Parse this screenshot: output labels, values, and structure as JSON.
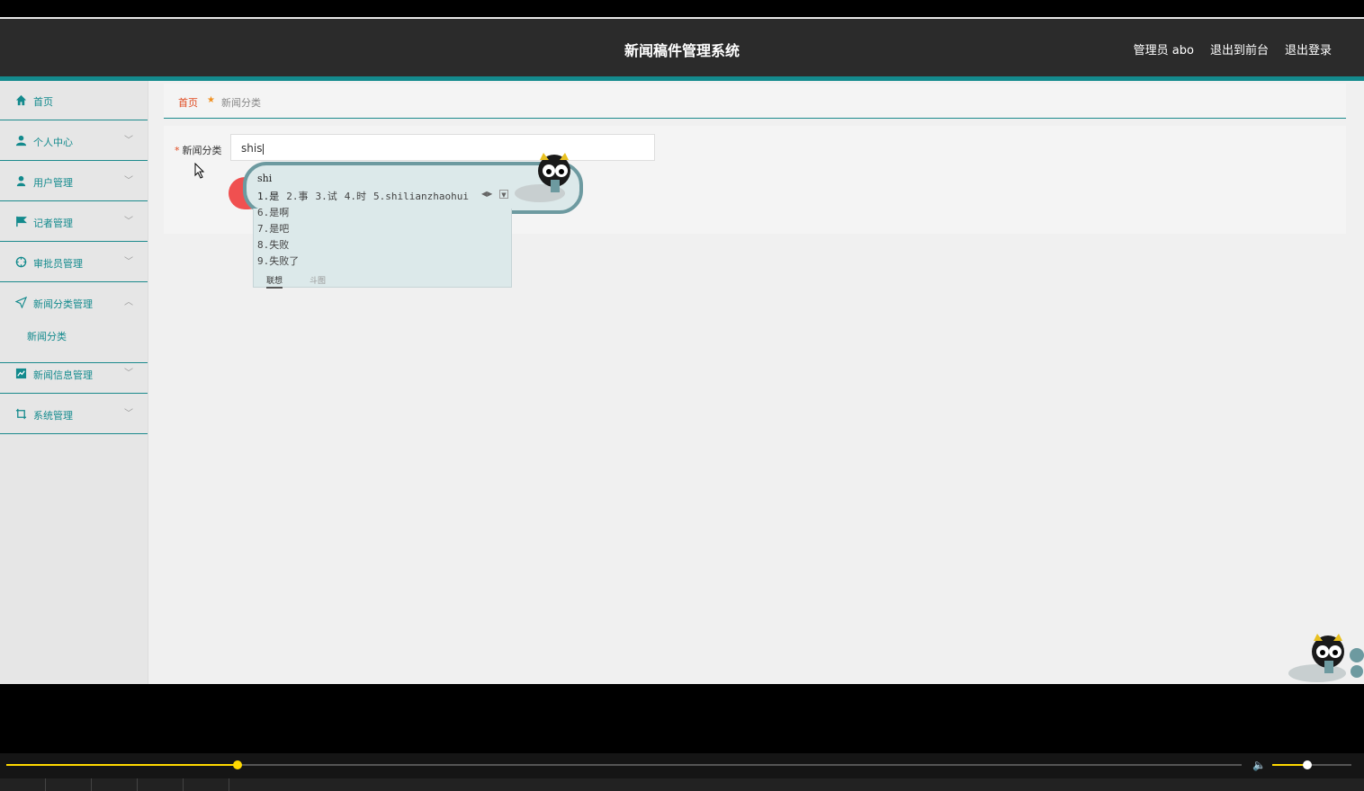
{
  "header": {
    "title": "新闻稿件管理系统",
    "admin": "管理员 abo",
    "exit_front": "退出到前台",
    "logout": "退出登录"
  },
  "colors": {
    "accent": "#138a8d",
    "header_bg": "#2b2b2b",
    "breadcrumb_home": "#e0491f",
    "player_accent": "#ffd900"
  },
  "sidebar": {
    "items": [
      {
        "label": "首页",
        "icon": "home-icon"
      },
      {
        "label": "个人中心",
        "icon": "user-icon"
      },
      {
        "label": "用户管理",
        "icon": "users-icon"
      },
      {
        "label": "记者管理",
        "icon": "flag-icon"
      },
      {
        "label": "审批员管理",
        "icon": "target-icon"
      },
      {
        "label": "新闻分类管理",
        "icon": "send-icon"
      },
      {
        "label": "新闻信息管理",
        "icon": "chart-icon"
      },
      {
        "label": "系统管理",
        "icon": "crop-icon"
      }
    ],
    "sub_item": "新闻分类"
  },
  "breadcrumb": {
    "home": "首页",
    "current": "新闻分类"
  },
  "form": {
    "label": "新闻分类",
    "required_mark": "*",
    "value": "shis"
  },
  "ime": {
    "pinyin": "shi",
    "candidates": [
      "1.是",
      "2.事",
      "3.试",
      "4.时",
      "5.shilianzhaohui"
    ],
    "more": [
      "6.是啊",
      "7.是吧",
      "8.失败",
      "9.失败了"
    ],
    "tabs": [
      "联想",
      "斗图"
    ]
  },
  "player": {
    "progress": 0.187,
    "volume": 0.44
  }
}
